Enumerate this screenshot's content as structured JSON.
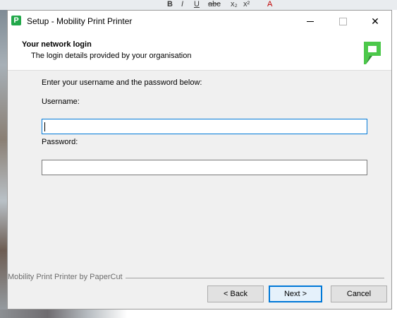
{
  "background": {
    "toolbar_glyphs": [
      "B",
      "I",
      "U",
      "abc",
      "x₂",
      "x²",
      "A"
    ]
  },
  "window": {
    "title": "Setup - Mobility Print Printer",
    "icon_letter": "P",
    "controls": {
      "minimize": "minimize-icon",
      "maximize": "maximize-icon",
      "close": "✕"
    }
  },
  "header": {
    "title": "Your network login",
    "subtitle": "The login details provided by your organisation",
    "logo_color": "#4cc84a"
  },
  "form": {
    "instruction": "Enter your username and the password below:",
    "username_label": "Username:",
    "username_value": "",
    "password_label": "Password:",
    "password_value": ""
  },
  "footer": {
    "branding": "Mobility Print Printer by PaperCut"
  },
  "buttons": {
    "back": "< Back",
    "next": "Next >",
    "cancel": "Cancel"
  },
  "colors": {
    "accent": "#0078d7",
    "brand_green": "#22a84a"
  }
}
